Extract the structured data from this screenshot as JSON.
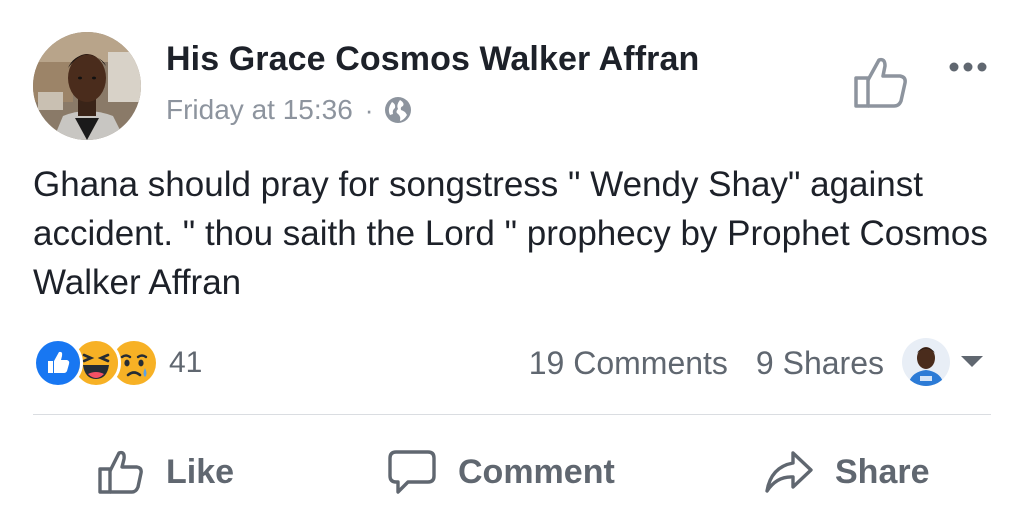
{
  "post": {
    "author_name": "His Grace  Cosmos Walker Affran",
    "timestamp": "Friday at 15:36",
    "separator": "·",
    "privacy_icon": "globe-icon",
    "text": "Ghana should pray for songstress \" Wendy Shay\" against accident. \" thou saith the Lord \" prophecy by Prophet Cosmos Walker Affran"
  },
  "header": {
    "like_icon": "thumbs-up-outline-icon",
    "more_icon": "more-options-icon"
  },
  "reactions": {
    "icons": [
      "like-reaction-icon",
      "haha-reaction-icon",
      "sad-reaction-icon"
    ],
    "count": "41",
    "colors": {
      "like": "#1877f2",
      "emoji": "#f7b125"
    }
  },
  "engagement": {
    "comments": "19 Comments",
    "shares": "9 Shares"
  },
  "actions": {
    "like_label": "Like",
    "comment_label": "Comment",
    "share_label": "Share"
  },
  "colors": {
    "text_primary": "#1d2129",
    "text_secondary": "#606770",
    "meta": "#8d949e",
    "divider": "#dadde1"
  }
}
